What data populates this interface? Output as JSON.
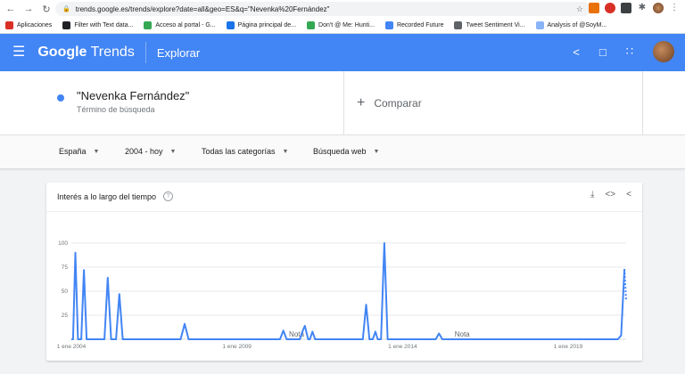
{
  "browser": {
    "url": "trends.google.es/trends/explore?date=all&geo=ES&q=\"Nevenka%20Fernández\"",
    "bookmarks": [
      {
        "label": "Aplicaciones",
        "color": "#d93025"
      },
      {
        "label": "Filter with Text data...",
        "color": "#202124"
      },
      {
        "label": "Acceso al portal - G...",
        "color": "#34a853"
      },
      {
        "label": "Página principal de...",
        "color": "#1a73e8"
      },
      {
        "label": "Don't @ Me: Hunti...",
        "color": "#34a853"
      },
      {
        "label": "Recorded Future",
        "color": "#4285f4"
      },
      {
        "label": "Tweet Sentiment Vi...",
        "color": "#5f6368"
      },
      {
        "label": "Analysis of @SoyM...",
        "color": "#8ab4f8"
      }
    ]
  },
  "header": {
    "logo_google": "Google",
    "logo_trends": "Trends",
    "section": "Explorar"
  },
  "term": {
    "name": "\"Nevenka Fernández\"",
    "subtitle": "Término de búsqueda",
    "color": "#4285f4",
    "compare_label": "Comparar"
  },
  "filters": {
    "region": "España",
    "period": "2004 - hoy",
    "category": "Todas las categorías",
    "search_type": "Búsqueda web"
  },
  "card": {
    "title": "Interés a lo largo del tiempo"
  },
  "chart_data": {
    "type": "line",
    "title": "Interés a lo largo del tiempo",
    "ylim": [
      0,
      100
    ],
    "yticks": [
      "100",
      "75",
      "50",
      "25"
    ],
    "xlabels": [
      "1 ene 2004",
      "1 ene 2009",
      "1 ene 2014",
      "1 ene 2019"
    ],
    "x_tick_years": [
      2004,
      2009,
      2014,
      2019
    ],
    "x_range": [
      2004.0,
      2020.75
    ],
    "notes": [
      {
        "label": "Nota",
        "x": 2010.8
      },
      {
        "label": "Nota",
        "x": 2015.8
      }
    ],
    "series": [
      {
        "color": "#4285f4",
        "points": [
          [
            2004.0,
            0
          ],
          [
            2004.05,
            0
          ],
          [
            2004.12,
            90
          ],
          [
            2004.2,
            0
          ],
          [
            2004.3,
            0
          ],
          [
            2004.38,
            72
          ],
          [
            2004.46,
            0
          ],
          [
            2005.0,
            0
          ],
          [
            2005.1,
            64
          ],
          [
            2005.2,
            0
          ],
          [
            2005.35,
            0
          ],
          [
            2005.45,
            47
          ],
          [
            2005.55,
            0
          ],
          [
            2007.3,
            0
          ],
          [
            2007.42,
            16
          ],
          [
            2007.54,
            0
          ],
          [
            2010.3,
            0
          ],
          [
            2010.4,
            9
          ],
          [
            2010.5,
            0
          ],
          [
            2010.9,
            0
          ],
          [
            2011.0,
            10
          ],
          [
            2011.05,
            14
          ],
          [
            2011.15,
            0
          ],
          [
            2011.2,
            0
          ],
          [
            2011.28,
            8
          ],
          [
            2011.36,
            0
          ],
          [
            2012.8,
            0
          ],
          [
            2012.9,
            36
          ],
          [
            2013.0,
            0
          ],
          [
            2013.1,
            0
          ],
          [
            2013.18,
            8
          ],
          [
            2013.25,
            0
          ],
          [
            2013.35,
            0
          ],
          [
            2013.45,
            100
          ],
          [
            2013.55,
            0
          ],
          [
            2015.0,
            0
          ],
          [
            2015.1,
            6
          ],
          [
            2015.2,
            0
          ],
          [
            2020.5,
            0
          ],
          [
            2020.6,
            4
          ],
          [
            2020.7,
            73
          ]
        ],
        "partial_tail": [
          [
            2020.7,
            73
          ],
          [
            2020.75,
            40
          ]
        ]
      }
    ]
  }
}
